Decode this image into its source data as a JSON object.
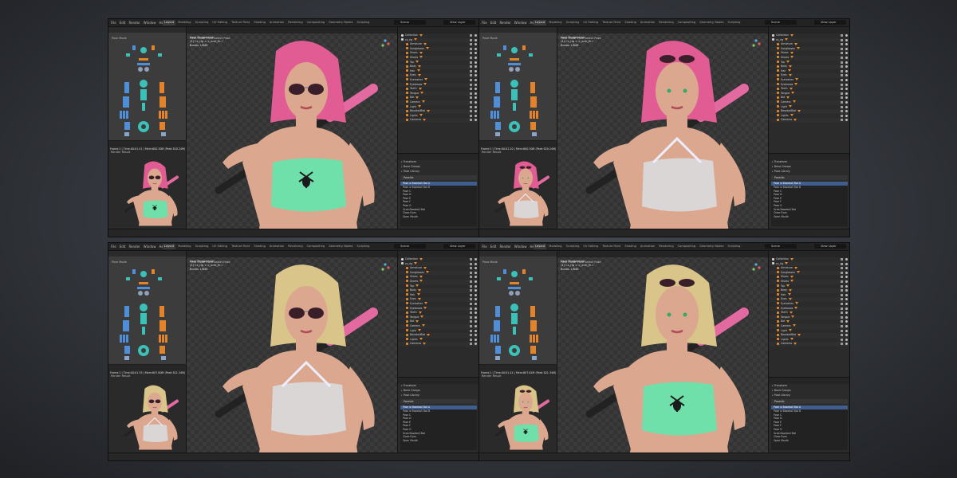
{
  "top_menu": [
    "File",
    "Edit",
    "Render",
    "Window",
    "Help"
  ],
  "workspace_tabs": [
    "Layout",
    "Modeling",
    "Sculpting",
    "UV Editing",
    "Texture Paint",
    "Shading",
    "Animation",
    "Rendering",
    "Compositing",
    "Geometry Nodes",
    "Scripting"
  ],
  "scene_name": "Scene",
  "view_layer": "View Layer",
  "picker_header": "Pose Mode",
  "render_header": "Render Result",
  "viewport_header": "Pose Mode   View   Select   Pose",
  "viewport_info": [
    "User Perspective",
    "(1) Cs_rig > c_arm_fk.l",
    "Bones   1/846"
  ],
  "timeline_label": "Playback   Keying   View   Marker",
  "outliner_rows": [
    "Collection",
    "cs_rig",
    "Armature",
    "Sunglasses",
    "Shoes",
    "Shorts",
    "Top",
    "Body",
    "Hair",
    "Eyes",
    "Eyelashes",
    "Eyebrows",
    "Teeth",
    "Tongue",
    "Bat",
    "Camera",
    "Light",
    "BaseballBat",
    "Lights",
    "Cameras"
  ],
  "pose_library_sections": [
    "Transform",
    "Bone Groups",
    "Pose Library"
  ],
  "pose_library_name": "PoseLib",
  "pose_list": [
    "Pose w Baseball Bat A",
    "Pose w Baseball Bat B",
    "Pose C",
    "Pose D",
    "Pose E",
    "Pose F",
    "Pose G",
    "Grab Baseball Bat",
    "Close Eyes",
    "Open Mouth"
  ],
  "panels": [
    {
      "render_info": "Frame:1 | Time:00:01.41 | Mem:600.30M (Peak 820.24M)",
      "hair": "#e25c94",
      "top": "sports",
      "glasses": "on-face"
    },
    {
      "render_info": "Frame:1 | Time:00:01.20 | Mem:600.30M (Peak 820.24M)",
      "hair": "#e25c94",
      "top": "mesh",
      "glasses": "on-head"
    },
    {
      "render_info": "Frame:1 | Time:00:01.35 | Mem:607.80M (Peak 821.34M)",
      "hair": "#d9c48a",
      "top": "mesh",
      "glasses": "on-face"
    },
    {
      "render_info": "Frame:1 | Time:00:01.44 | Mem:607.61M (Peak 821.34M)",
      "hair": "#d9c48a",
      "top": "sports",
      "glasses": "on-head"
    }
  ],
  "colors": {
    "rig_blue": "#4f8fd8",
    "rig_orange": "#e2832c",
    "rig_teal": "#3bc1b8",
    "sports_top": "#6fe0a9",
    "mesh_top": "#d9dee3",
    "skin": "#dba88f",
    "bat": "#e36aa0"
  }
}
